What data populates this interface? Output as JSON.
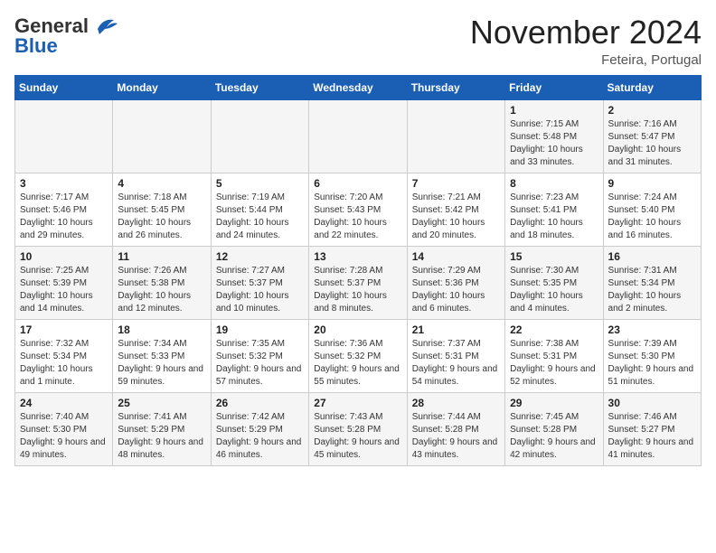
{
  "header": {
    "logo_line1": "General",
    "logo_line2": "Blue",
    "month_title": "November 2024",
    "location": "Feteira, Portugal"
  },
  "days_of_week": [
    "Sunday",
    "Monday",
    "Tuesday",
    "Wednesday",
    "Thursday",
    "Friday",
    "Saturday"
  ],
  "weeks": [
    [
      {
        "day": "",
        "info": ""
      },
      {
        "day": "",
        "info": ""
      },
      {
        "day": "",
        "info": ""
      },
      {
        "day": "",
        "info": ""
      },
      {
        "day": "",
        "info": ""
      },
      {
        "day": "1",
        "info": "Sunrise: 7:15 AM\nSunset: 5:48 PM\nDaylight: 10 hours and 33 minutes."
      },
      {
        "day": "2",
        "info": "Sunrise: 7:16 AM\nSunset: 5:47 PM\nDaylight: 10 hours and 31 minutes."
      }
    ],
    [
      {
        "day": "3",
        "info": "Sunrise: 7:17 AM\nSunset: 5:46 PM\nDaylight: 10 hours and 29 minutes."
      },
      {
        "day": "4",
        "info": "Sunrise: 7:18 AM\nSunset: 5:45 PM\nDaylight: 10 hours and 26 minutes."
      },
      {
        "day": "5",
        "info": "Sunrise: 7:19 AM\nSunset: 5:44 PM\nDaylight: 10 hours and 24 minutes."
      },
      {
        "day": "6",
        "info": "Sunrise: 7:20 AM\nSunset: 5:43 PM\nDaylight: 10 hours and 22 minutes."
      },
      {
        "day": "7",
        "info": "Sunrise: 7:21 AM\nSunset: 5:42 PM\nDaylight: 10 hours and 20 minutes."
      },
      {
        "day": "8",
        "info": "Sunrise: 7:23 AM\nSunset: 5:41 PM\nDaylight: 10 hours and 18 minutes."
      },
      {
        "day": "9",
        "info": "Sunrise: 7:24 AM\nSunset: 5:40 PM\nDaylight: 10 hours and 16 minutes."
      }
    ],
    [
      {
        "day": "10",
        "info": "Sunrise: 7:25 AM\nSunset: 5:39 PM\nDaylight: 10 hours and 14 minutes."
      },
      {
        "day": "11",
        "info": "Sunrise: 7:26 AM\nSunset: 5:38 PM\nDaylight: 10 hours and 12 minutes."
      },
      {
        "day": "12",
        "info": "Sunrise: 7:27 AM\nSunset: 5:37 PM\nDaylight: 10 hours and 10 minutes."
      },
      {
        "day": "13",
        "info": "Sunrise: 7:28 AM\nSunset: 5:37 PM\nDaylight: 10 hours and 8 minutes."
      },
      {
        "day": "14",
        "info": "Sunrise: 7:29 AM\nSunset: 5:36 PM\nDaylight: 10 hours and 6 minutes."
      },
      {
        "day": "15",
        "info": "Sunrise: 7:30 AM\nSunset: 5:35 PM\nDaylight: 10 hours and 4 minutes."
      },
      {
        "day": "16",
        "info": "Sunrise: 7:31 AM\nSunset: 5:34 PM\nDaylight: 10 hours and 2 minutes."
      }
    ],
    [
      {
        "day": "17",
        "info": "Sunrise: 7:32 AM\nSunset: 5:34 PM\nDaylight: 10 hours and 1 minute."
      },
      {
        "day": "18",
        "info": "Sunrise: 7:34 AM\nSunset: 5:33 PM\nDaylight: 9 hours and 59 minutes."
      },
      {
        "day": "19",
        "info": "Sunrise: 7:35 AM\nSunset: 5:32 PM\nDaylight: 9 hours and 57 minutes."
      },
      {
        "day": "20",
        "info": "Sunrise: 7:36 AM\nSunset: 5:32 PM\nDaylight: 9 hours and 55 minutes."
      },
      {
        "day": "21",
        "info": "Sunrise: 7:37 AM\nSunset: 5:31 PM\nDaylight: 9 hours and 54 minutes."
      },
      {
        "day": "22",
        "info": "Sunrise: 7:38 AM\nSunset: 5:31 PM\nDaylight: 9 hours and 52 minutes."
      },
      {
        "day": "23",
        "info": "Sunrise: 7:39 AM\nSunset: 5:30 PM\nDaylight: 9 hours and 51 minutes."
      }
    ],
    [
      {
        "day": "24",
        "info": "Sunrise: 7:40 AM\nSunset: 5:30 PM\nDaylight: 9 hours and 49 minutes."
      },
      {
        "day": "25",
        "info": "Sunrise: 7:41 AM\nSunset: 5:29 PM\nDaylight: 9 hours and 48 minutes."
      },
      {
        "day": "26",
        "info": "Sunrise: 7:42 AM\nSunset: 5:29 PM\nDaylight: 9 hours and 46 minutes."
      },
      {
        "day": "27",
        "info": "Sunrise: 7:43 AM\nSunset: 5:28 PM\nDaylight: 9 hours and 45 minutes."
      },
      {
        "day": "28",
        "info": "Sunrise: 7:44 AM\nSunset: 5:28 PM\nDaylight: 9 hours and 43 minutes."
      },
      {
        "day": "29",
        "info": "Sunrise: 7:45 AM\nSunset: 5:28 PM\nDaylight: 9 hours and 42 minutes."
      },
      {
        "day": "30",
        "info": "Sunrise: 7:46 AM\nSunset: 5:27 PM\nDaylight: 9 hours and 41 minutes."
      }
    ]
  ]
}
